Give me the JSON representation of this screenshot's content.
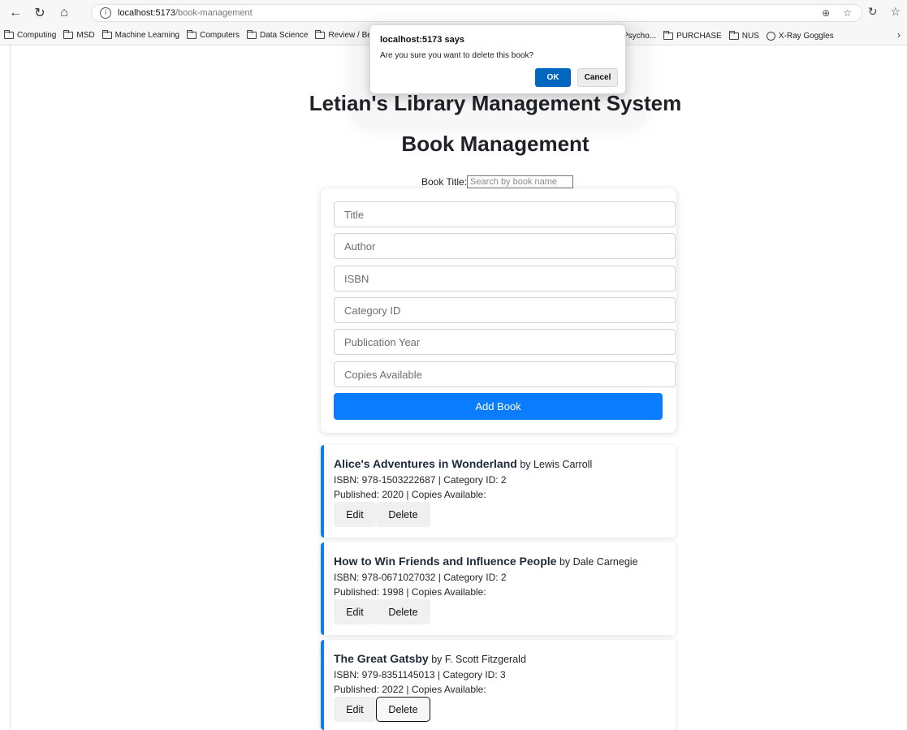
{
  "browser": {
    "url_host": "localhost:5173",
    "url_path": "/book-management",
    "bookmarks_left": [
      "Computing",
      "MSD",
      "Machine Learning",
      "Computers",
      "Data Science",
      "Review / Benchmar"
    ],
    "bookmarks_right": [
      {
        "label": "Psycho...",
        "icon": "folder-icon"
      },
      {
        "label": "PURCHASE",
        "icon": "folder-icon"
      },
      {
        "label": "NUS",
        "icon": "folder-icon"
      },
      {
        "label": "X-Ray Goggles",
        "icon": "globe-icon"
      }
    ]
  },
  "dialog": {
    "title": "localhost:5173 says",
    "message": "Are you sure you want to delete this book?",
    "ok_label": "OK",
    "cancel_label": "Cancel"
  },
  "page": {
    "site_title": "Letian's Library Management System",
    "page_title": "Book Management",
    "search_label": "Book Title:",
    "search_placeholder": "Search by book name"
  },
  "form": {
    "title_placeholder": "Title",
    "author_placeholder": "Author",
    "isbn_placeholder": "ISBN",
    "category_placeholder": "Category ID",
    "year_placeholder": "Publication Year",
    "copies_placeholder": "Copies Available",
    "add_label": "Add Book"
  },
  "books": [
    {
      "title": "Alice's Adventures in Wonderland",
      "by": "by Lewis Carroll",
      "isbn_line": "ISBN: 978-1503222687 | Category ID: 2",
      "pub_line": "Published: 2020 | Copies Available:",
      "edit_label": "Edit",
      "delete_label": "Delete"
    },
    {
      "title": "How to Win Friends and Influence People",
      "by": "by Dale Carnegie",
      "isbn_line": "ISBN: 978-0671027032 | Category ID: 2",
      "pub_line": "Published: 1998 | Copies Available:",
      "edit_label": "Edit",
      "delete_label": "Delete"
    },
    {
      "title": "The Great Gatsby",
      "by": "by F. Scott Fitzgerald",
      "isbn_line": "ISBN: 979-8351145013 | Category ID: 3",
      "pub_line": "Published: 2022 | Copies Available:",
      "edit_label": "Edit",
      "delete_label": "Delete"
    }
  ],
  "colors": {
    "accent": "#0a7cff",
    "dialog_ok": "#0067c0"
  }
}
